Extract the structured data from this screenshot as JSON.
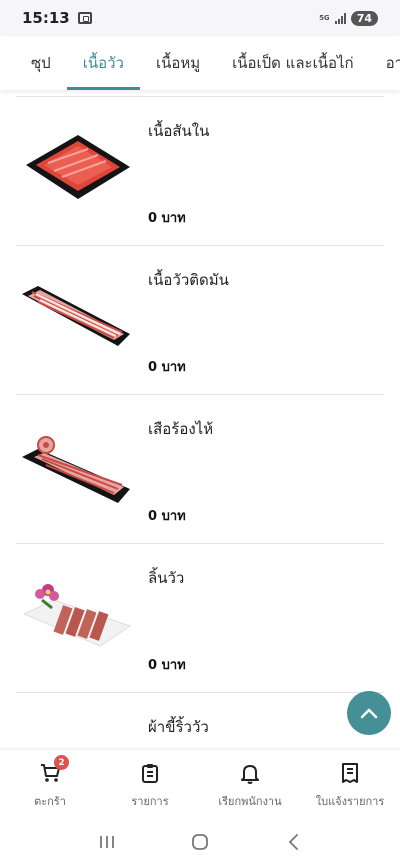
{
  "status_bar": {
    "time": "15:13",
    "network": "5G",
    "battery": "74"
  },
  "tabs": [
    {
      "label": "ซุป",
      "active": false
    },
    {
      "label": "เนื้อวัว",
      "active": true
    },
    {
      "label": "เนื้อหมู",
      "active": false
    },
    {
      "label": "เนื้อเป็ด และเนื้อไก่",
      "active": false
    },
    {
      "label": "อา",
      "active": false
    }
  ],
  "products": [
    {
      "name": "เนื้อสันใน",
      "price": "0 บาท"
    },
    {
      "name": "เนื้อวัวติดมัน",
      "price": "0 บาท"
    },
    {
      "name": "เสือร้องไห้",
      "price": "0 บาท"
    },
    {
      "name": "ลิ้นวัว",
      "price": "0 บาท"
    },
    {
      "name": "ผ้าขี้ริ้ววัว",
      "price": ""
    }
  ],
  "bottom_nav": {
    "cart": {
      "label": "ตะกร้า",
      "badge": "2",
      "icon": "cart-icon"
    },
    "orders": {
      "label": "รายการ",
      "icon": "clipboard-icon"
    },
    "call_staff": {
      "label": "เรียกพนักงาน",
      "icon": "bell-icon"
    },
    "receipt": {
      "label": "ใบแจ้งรายการ",
      "icon": "receipt-icon"
    }
  },
  "colors": {
    "accent": "#3e8c98",
    "fab": "#458f97",
    "badge": "#e05252"
  }
}
